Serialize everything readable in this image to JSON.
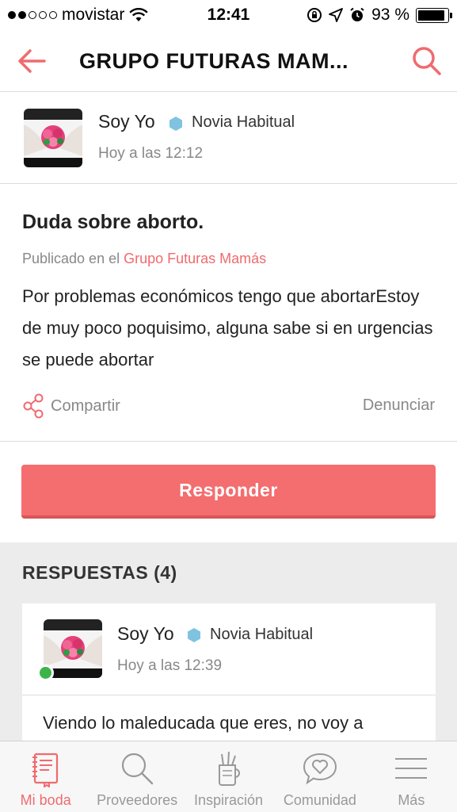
{
  "status_bar": {
    "carrier": "movistar",
    "time": "12:41",
    "battery": "93 %",
    "battery_level": 0.93,
    "icons": [
      "signal-dots-icon",
      "wifi-icon",
      "rotation-lock-icon",
      "location-icon",
      "alarm-icon",
      "battery-icon"
    ]
  },
  "nav": {
    "title": "GRUPO FUTURAS MAM...",
    "back_icon": "back-arrow-icon",
    "search_icon": "search-icon"
  },
  "post": {
    "author": {
      "name": "Soy Yo",
      "role": "Novia Habitual",
      "time": "Hoy a las 12:12",
      "badge_color": "#7fc3e0"
    },
    "title": "Duda sobre aborto.",
    "published_prefix": "Publicado en el",
    "group_link": "Grupo Futuras Mamás",
    "body": "Por problemas económicos tengo que abortarEstoy de muy poco poquisimo, alguna sabe si en urgencias se puede abortar",
    "share_label": "Compartir",
    "report_label": "Denunciar",
    "reply_button": "Responder"
  },
  "responses": {
    "header": "RESPUESTAS (4)",
    "items": [
      {
        "author": "Soy Yo",
        "role": "Novia Habitual",
        "time": "Hoy a las 12:39",
        "online": true,
        "text": "Viendo lo maleducada que eres, no voy a"
      }
    ]
  },
  "tabs": [
    {
      "label": "Mi boda",
      "icon": "notebook-icon",
      "active": true
    },
    {
      "label": "Proveedores",
      "icon": "search-icon",
      "active": false
    },
    {
      "label": "Inspiración",
      "icon": "pencil-cup-icon",
      "active": false
    },
    {
      "label": "Comunidad",
      "icon": "heart-bubble-icon",
      "active": false
    },
    {
      "label": "Más",
      "icon": "menu-icon",
      "active": false
    }
  ],
  "colors": {
    "accent": "#ef6b6f",
    "button": "#f46d6f",
    "online": "#3cb44a"
  }
}
